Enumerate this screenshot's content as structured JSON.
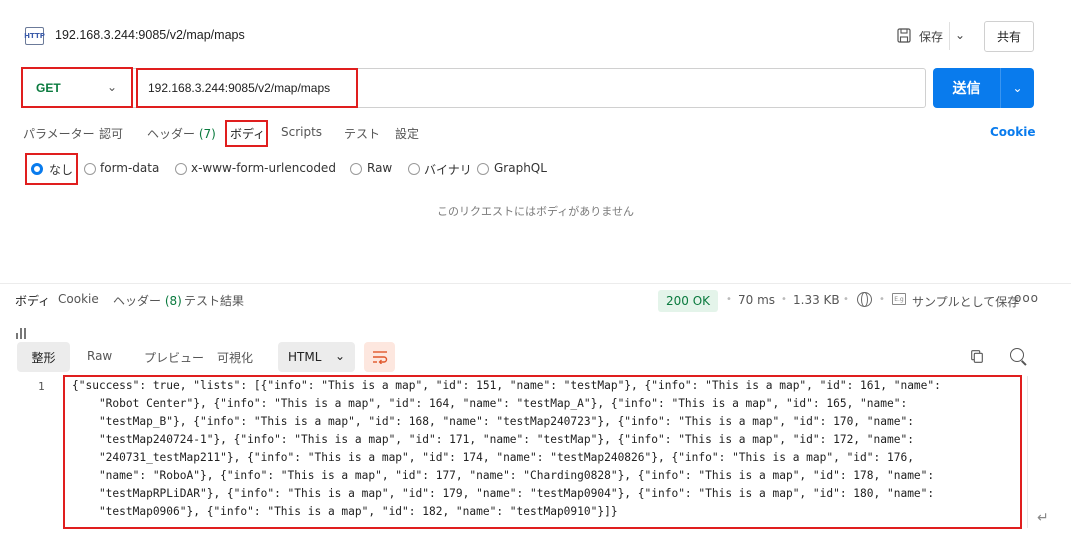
{
  "window": {
    "icon_label": "HTTP",
    "title": "192.168.3.244:9085/v2/map/maps",
    "save_label": "保存",
    "share_label": "共有"
  },
  "request": {
    "method": "GET",
    "url": "192.168.3.244:9085/v2/map/maps",
    "send_label": "送信"
  },
  "request_tabs": {
    "params": "パラメーター",
    "auth": "認可",
    "headers": "ヘッダー",
    "headers_count": "(7)",
    "body": "ボディ",
    "scripts": "Scripts",
    "tests": "テスト",
    "settings": "設定",
    "cookie": "Cookie"
  },
  "body_types": {
    "none": "なし",
    "form_data": "form-data",
    "urlencoded": "x-www-form-urlencoded",
    "raw": "Raw",
    "binary": "バイナリ",
    "graphql": "GraphQL",
    "selected": "none"
  },
  "empty_body_message": "このリクエストにはボディがありません",
  "response": {
    "tabs": {
      "body": "ボディ",
      "cookie": "Cookie",
      "headers": "ヘッダー",
      "headers_count": "(8)",
      "test_results": "テスト結果"
    },
    "status": "200 OK",
    "time": "70 ms",
    "size": "1.33 KB",
    "save_as_example": "サンプルとして保存",
    "more": "ooo",
    "format_tabs": {
      "pretty": "整形",
      "raw": "Raw",
      "preview": "プレビュー",
      "visualize": "可視化"
    },
    "format": "HTML",
    "line_number": "1",
    "code_lines": [
      "{\"success\": true, \"lists\": [{\"info\": \"This is a map\", \"id\": 151, \"name\": \"testMap\"}, {\"info\": \"This is a map\", \"id\": 161, \"name\":",
      "    \"Robot Center\"}, {\"info\": \"This is a map\", \"id\": 164, \"name\": \"testMap_A\"}, {\"info\": \"This is a map\", \"id\": 165, \"name\":",
      "    \"testMap_B\"}, {\"info\": \"This is a map\", \"id\": 168, \"name\": \"testMap240723\"}, {\"info\": \"This is a map\", \"id\": 170, \"name\":",
      "    \"testMap240724-1\"}, {\"info\": \"This is a map\", \"id\": 171, \"name\": \"testMap\"}, {\"info\": \"This is a map\", \"id\": 172, \"name\":",
      "    \"240731_testMap211\"}, {\"info\": \"This is a map\", \"id\": 174, \"name\": \"testMap240826\"}, {\"info\": \"This is a map\", \"id\": 176,",
      "    \"name\": \"RoboA\"}, {\"info\": \"This is a map\", \"id\": 177, \"name\": \"Charding0828\"}, {\"info\": \"This is a map\", \"id\": 178, \"name\":",
      "    \"testMapRPLiDAR\"}, {\"info\": \"This is a map\", \"id\": 179, \"name\": \"testMap0904\"}, {\"info\": \"This is a map\", \"id\": 180, \"name\":",
      "    \"testMap0906\"}, {\"info\": \"This is a map\", \"id\": 182, \"name\": \"testMap0910\"}]}"
    ]
  },
  "colors": {
    "accent": "#097bed",
    "method_get": "#0a7a3e",
    "highlight_box": "#e01e1e",
    "status_ok_bg": "#e4f4ea"
  }
}
